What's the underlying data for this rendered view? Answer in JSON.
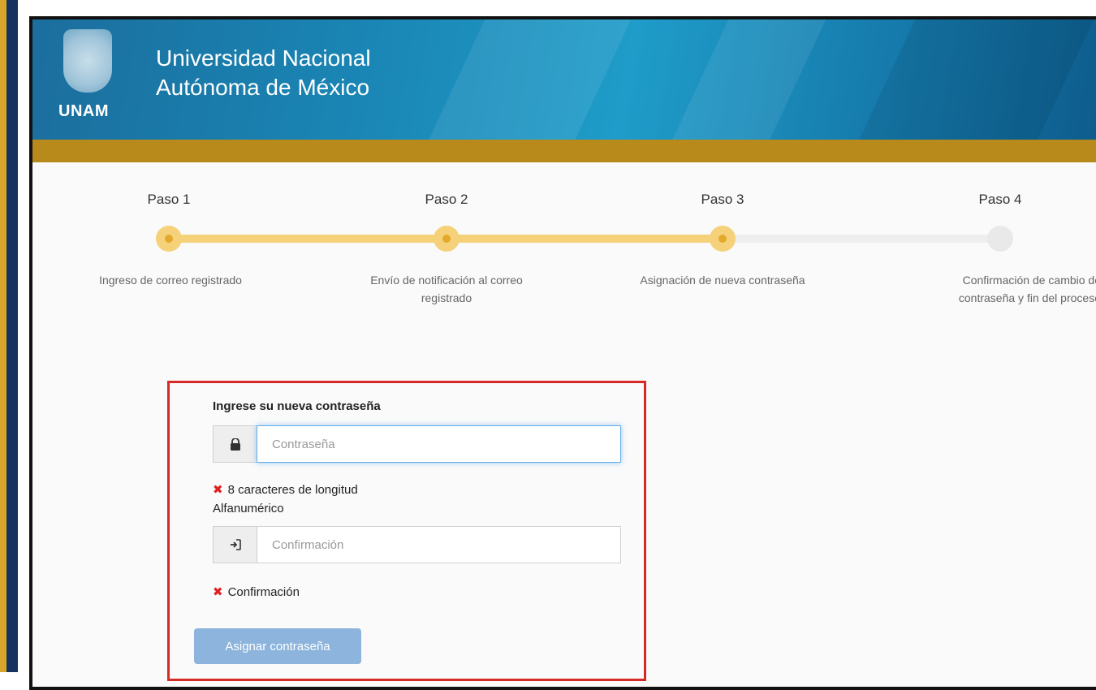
{
  "header": {
    "logo_text": "UNAM",
    "title_line1": "Universidad Nacional",
    "title_line2": "Autónoma de México"
  },
  "steps": [
    {
      "title": "Paso 1",
      "desc_line1": "Ingreso de correo registrado",
      "desc_line2": "",
      "state": "active"
    },
    {
      "title": "Paso 2",
      "desc_line1": "Envío de notificación al correo",
      "desc_line2": "registrado",
      "state": "active"
    },
    {
      "title": "Paso 3",
      "desc_line1": "Asignación de nueva contraseña",
      "desc_line2": "",
      "state": "active"
    },
    {
      "title": "Paso 4",
      "desc_line1": "Confirmación de cambio de",
      "desc_line2": "contraseña y fin del proceso",
      "state": "inactive"
    }
  ],
  "form": {
    "heading": "Ingrese su nueva contraseña",
    "password_placeholder": "Contraseña",
    "password_value": "",
    "rule_length": "8 caracteres de longitud",
    "rule_alnum": "Alfanumérico",
    "confirm_placeholder": "Confirmación",
    "confirm_value": "",
    "rule_confirm": "Confirmación",
    "submit_label": "Asignar contraseña"
  },
  "colors": {
    "step_active": "#f5d27a",
    "step_active_center": "#e4a82b",
    "step_inactive": "#e9e9e9",
    "error": "#e02020",
    "submit_bg": "#8cb4dc",
    "highlight_border": "#d62a26",
    "gold_bar": "#b88a1c"
  },
  "icons": {
    "password_addon": "lock-icon",
    "confirm_addon": "sign-in-icon",
    "rule_status": "x-icon"
  }
}
